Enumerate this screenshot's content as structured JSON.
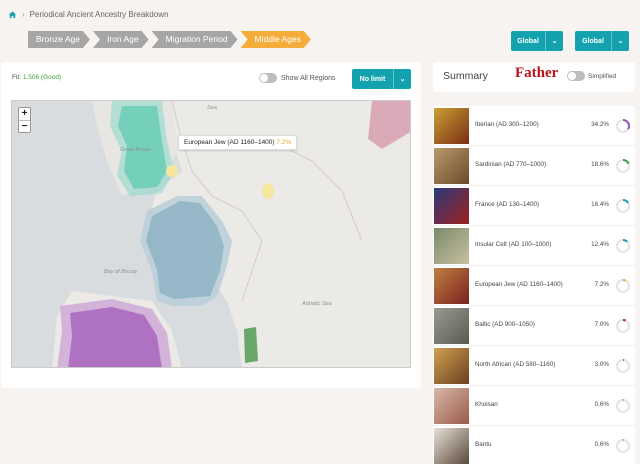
{
  "breadcrumb": {
    "label": "Periodical Ancient Ancestry Breakdown"
  },
  "eras": [
    "Bronze Age",
    "Iron Age",
    "Migration Period",
    "Middle Ages"
  ],
  "active_era": "Middle Ages",
  "scope_buttons": [
    "Global",
    "Global"
  ],
  "fit": {
    "label": "Fit:",
    "value": "1.506 (Good)"
  },
  "show_all_regions": "Show All Regions",
  "limit_button": "No limit",
  "map": {
    "tooltip_name": "European Jew (AD 1160–1400)",
    "tooltip_pct": "7.2%",
    "labels": {
      "great_britain": "Great Britain",
      "biscay": "Bay of Biscay",
      "sea": "Sea",
      "adriatic": "Adriatic Sea"
    }
  },
  "summary": {
    "title": "Summary",
    "father": "Father",
    "simplified": "Simplified"
  },
  "colors": {
    "teal": "#14a3ae",
    "active_era": "#f6ac3a",
    "inactive_era": "#a6a6a6",
    "fit_good": "#3aa531",
    "father": "#c0121a"
  },
  "results": [
    {
      "name": "Iberian (AD 300–1200)",
      "pct": "34.2%",
      "value": 0.342,
      "color": "#9b59b6"
    },
    {
      "name": "Sardinian (AD 770–1000)",
      "pct": "18.6%",
      "value": 0.186,
      "color": "#3a9d4f"
    },
    {
      "name": "France (AD 130–1400)",
      "pct": "16.4%",
      "value": 0.164,
      "color": "#1aa3b5"
    },
    {
      "name": "Insular Celt (AD 100–1000)",
      "pct": "12.4%",
      "value": 0.124,
      "color": "#1aa3b5"
    },
    {
      "name": "European Jew (AD 1160–1400)",
      "pct": "7.2%",
      "value": 0.072,
      "color": "#f0a52d"
    },
    {
      "name": "Baltic (AD 900–1050)",
      "pct": "7.0%",
      "value": 0.07,
      "color": "#b0263a"
    },
    {
      "name": "North African (AD 580–1160)",
      "pct": "3.0%",
      "value": 0.03,
      "color": "#1aa3b5"
    },
    {
      "name": "Khoisan",
      "pct": "0.6%",
      "value": 0.006,
      "color": "#e07a3a"
    },
    {
      "name": "Bantu",
      "pct": "0.6%",
      "value": 0.006,
      "color": "#e07a3a"
    }
  ]
}
